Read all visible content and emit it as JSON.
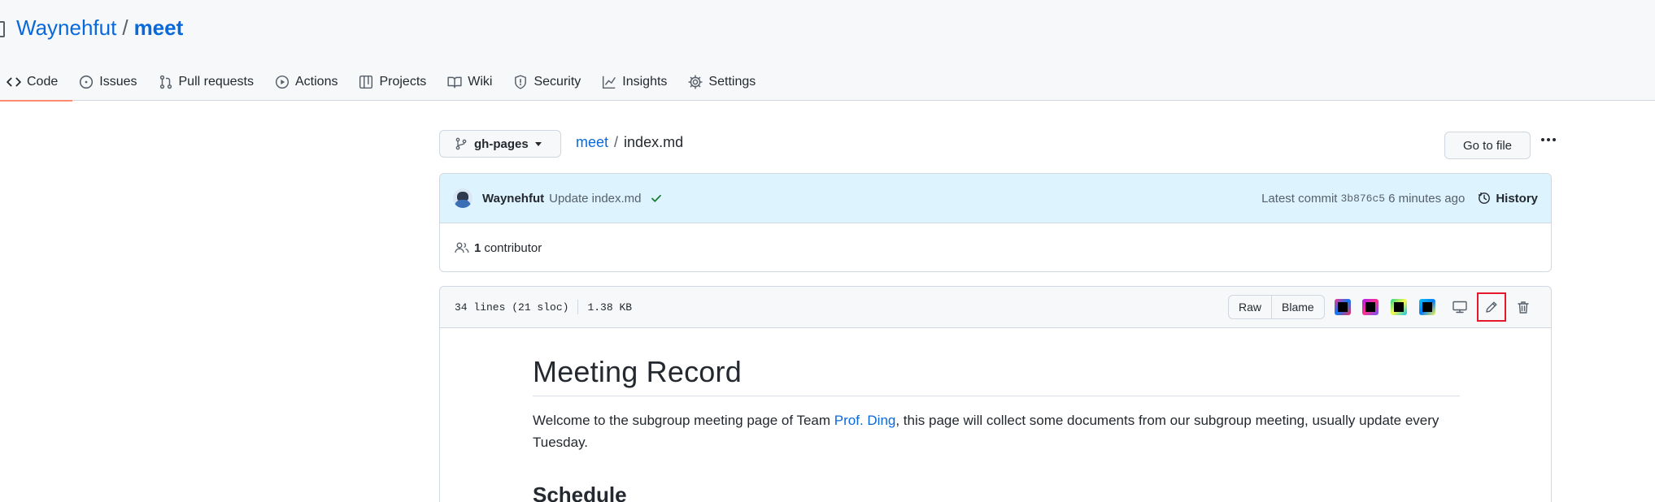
{
  "repo": {
    "owner": "Waynehfut",
    "separator": "/",
    "name": "meet"
  },
  "tabs": [
    {
      "label": "Code",
      "icon": "code-icon",
      "active": true
    },
    {
      "label": "Issues",
      "icon": "issue-icon"
    },
    {
      "label": "Pull requests",
      "icon": "pull-request-icon"
    },
    {
      "label": "Actions",
      "icon": "play-icon"
    },
    {
      "label": "Projects",
      "icon": "table-icon"
    },
    {
      "label": "Wiki",
      "icon": "book-icon"
    },
    {
      "label": "Security",
      "icon": "shield-icon"
    },
    {
      "label": "Insights",
      "icon": "graph-icon"
    },
    {
      "label": "Settings",
      "icon": "gear-icon"
    }
  ],
  "branch": {
    "label": "gh-pages"
  },
  "breadcrumb": {
    "root": "meet",
    "separator": "/",
    "file": "index.md"
  },
  "goto_file": "Go to file",
  "commit": {
    "author": "Waynehfut",
    "message": "Update index.md",
    "latest_label": "Latest commit",
    "sha": "3b876c5",
    "time": "6 minutes ago",
    "history_label": "History"
  },
  "contributors": {
    "count": "1",
    "label": "contributor"
  },
  "file": {
    "lines": "34 lines (21 sloc)",
    "size": "1.38 KB",
    "raw_label": "Raw",
    "blame_label": "Blame"
  },
  "readme": {
    "title": "Meeting Record",
    "intro_before": "Welcome to the subgroup meeting page of Team ",
    "intro_link": "Prof. Ding",
    "intro_after": ", this page will collect some documents from our subgroup meeting, usually update every Tuesday.",
    "next_heading": "Schedule"
  },
  "colors": {
    "accent": "#0969da",
    "tab_underline": "#fd8c73",
    "commit_bg": "#ddf4ff",
    "edit_highlight": "#e5192b"
  }
}
